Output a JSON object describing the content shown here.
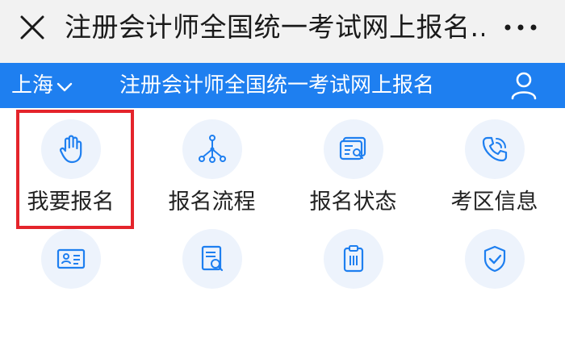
{
  "topbar": {
    "title": "注册会计师全国统一考试网上报名...",
    "close_icon": "close-icon",
    "more_icon": "more-dots-icon"
  },
  "header": {
    "region": "上海",
    "site_title": "注册会计师全国统一考试网上报名",
    "user_icon": "user-icon",
    "background_color": "#1e7ff0"
  },
  "menu": {
    "items": [
      {
        "label": "我要报名",
        "icon": "hand-icon"
      },
      {
        "label": "报名流程",
        "icon": "flow-icon"
      },
      {
        "label": "报名状态",
        "icon": "status-icon"
      },
      {
        "label": "考区信息",
        "icon": "phone-icon"
      }
    ],
    "row2_icons": [
      "id-card-icon",
      "document-search-icon",
      "clipboard-icon",
      "shield-check-icon"
    ]
  },
  "highlight": {
    "target": "我要报名",
    "color": "#e4242b"
  }
}
